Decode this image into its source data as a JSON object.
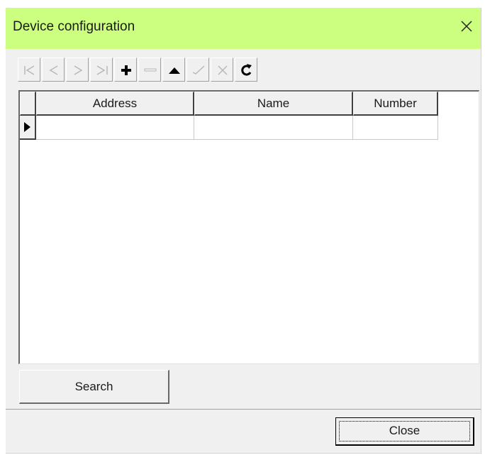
{
  "window": {
    "title": "Device configuration",
    "accent_color": "#ccff80"
  },
  "toolbar": {
    "buttons": [
      {
        "icon": "first-record-icon",
        "enabled": false
      },
      {
        "icon": "prior-record-icon",
        "enabled": false
      },
      {
        "icon": "next-record-icon",
        "enabled": false
      },
      {
        "icon": "last-record-icon",
        "enabled": false
      },
      {
        "icon": "insert-record-icon",
        "enabled": true
      },
      {
        "icon": "delete-record-icon",
        "enabled": false
      },
      {
        "icon": "edit-record-icon",
        "enabled": true
      },
      {
        "icon": "post-edit-icon",
        "enabled": false
      },
      {
        "icon": "cancel-edit-icon",
        "enabled": false
      },
      {
        "icon": "refresh-icon",
        "enabled": true
      }
    ]
  },
  "grid": {
    "columns": [
      "Address",
      "Name",
      "Number"
    ],
    "rows": [
      {
        "address": "",
        "name": "",
        "number": ""
      }
    ]
  },
  "buttons": {
    "search": "Search",
    "close": "Close"
  }
}
